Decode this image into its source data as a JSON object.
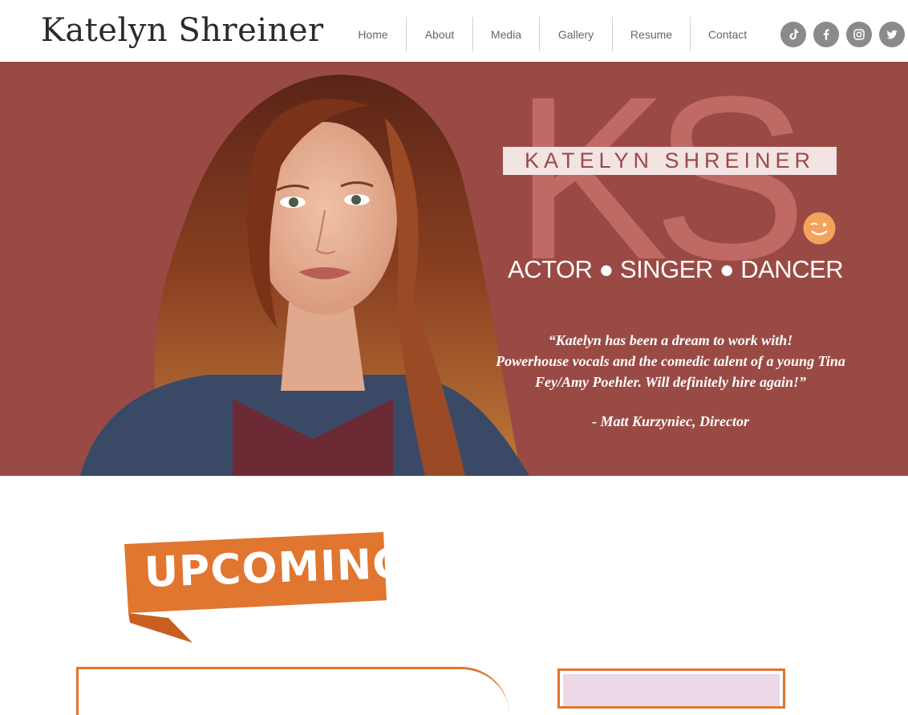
{
  "header": {
    "site_title": "Katelyn Shreiner",
    "nav": [
      "Home",
      "About",
      "Media",
      "Gallery",
      "Resume",
      "Contact"
    ],
    "social": [
      "tiktok-icon",
      "facebook-icon",
      "instagram-icon",
      "twitter-icon"
    ]
  },
  "hero": {
    "monogram": "KS",
    "name_banner": "KATELYN SHREINER",
    "tagline": "ACTOR ● SINGER ● DANCER",
    "quote_lines": [
      "“Katelyn has been a dream to work with!",
      "Powerhouse vocals and the comedic talent of a young Tina",
      "Fey/Amy Poehler. Will definitely hire again!”"
    ],
    "quote_author": "- Matt Kurzyniec, Director"
  },
  "upcoming": {
    "label": "UPCOMING"
  },
  "colors": {
    "hero_bg": "#9a4a44",
    "accent_orange": "#e0762f",
    "social_gray": "#8a8a8a"
  }
}
